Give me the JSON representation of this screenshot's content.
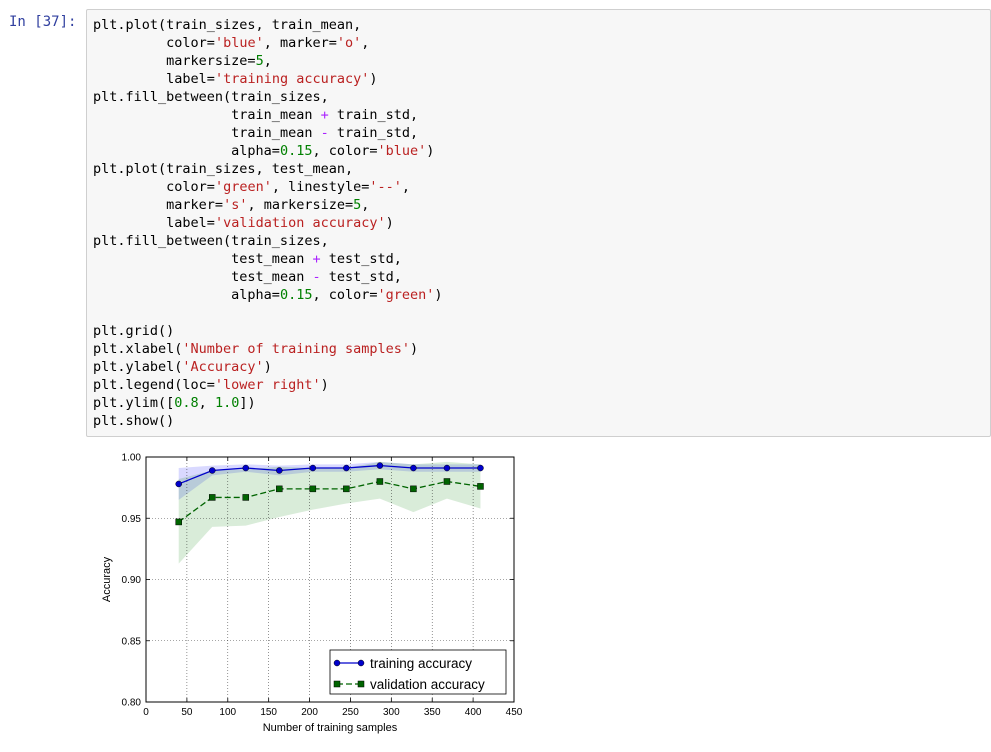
{
  "cell": {
    "prompt": "In [37]:",
    "lines": [
      {
        "indent": "",
        "parts": [
          {
            "t": "plt.plot(train_sizes, train_mean,"
          }
        ]
      },
      {
        "indent": "         ",
        "parts": [
          {
            "t": "color="
          },
          {
            "t": "'blue'",
            "c": "str"
          },
          {
            "t": ", marker="
          },
          {
            "t": "'o'",
            "c": "str"
          },
          {
            "t": ","
          }
        ]
      },
      {
        "indent": "         ",
        "parts": [
          {
            "t": "markersize="
          },
          {
            "t": "5",
            "c": "num"
          },
          {
            "t": ","
          }
        ]
      },
      {
        "indent": "         ",
        "parts": [
          {
            "t": "label="
          },
          {
            "t": "'training accuracy'",
            "c": "str"
          },
          {
            "t": ")"
          }
        ]
      },
      {
        "indent": "",
        "parts": [
          {
            "t": "plt.fill_between(train_sizes,"
          }
        ]
      },
      {
        "indent": "                 ",
        "parts": [
          {
            "t": "train_mean "
          },
          {
            "t": "+",
            "c": "op"
          },
          {
            "t": " train_std,"
          }
        ]
      },
      {
        "indent": "                 ",
        "parts": [
          {
            "t": "train_mean "
          },
          {
            "t": "-",
            "c": "op"
          },
          {
            "t": " train_std,"
          }
        ]
      },
      {
        "indent": "                 ",
        "parts": [
          {
            "t": "alpha="
          },
          {
            "t": "0.15",
            "c": "num"
          },
          {
            "t": ", color="
          },
          {
            "t": "'blue'",
            "c": "str"
          },
          {
            "t": ")"
          }
        ]
      },
      {
        "indent": "",
        "parts": [
          {
            "t": "plt.plot(train_sizes, test_mean,"
          }
        ]
      },
      {
        "indent": "         ",
        "parts": [
          {
            "t": "color="
          },
          {
            "t": "'green'",
            "c": "str"
          },
          {
            "t": ", linestyle="
          },
          {
            "t": "'--'",
            "c": "str"
          },
          {
            "t": ","
          }
        ]
      },
      {
        "indent": "         ",
        "parts": [
          {
            "t": "marker="
          },
          {
            "t": "'s'",
            "c": "str"
          },
          {
            "t": ", markersize="
          },
          {
            "t": "5",
            "c": "num"
          },
          {
            "t": ","
          }
        ]
      },
      {
        "indent": "         ",
        "parts": [
          {
            "t": "label="
          },
          {
            "t": "'validation accuracy'",
            "c": "str"
          },
          {
            "t": ")"
          }
        ]
      },
      {
        "indent": "",
        "parts": [
          {
            "t": "plt.fill_between(train_sizes,"
          }
        ]
      },
      {
        "indent": "                 ",
        "parts": [
          {
            "t": "test_mean "
          },
          {
            "t": "+",
            "c": "op"
          },
          {
            "t": " test_std,"
          }
        ]
      },
      {
        "indent": "                 ",
        "parts": [
          {
            "t": "test_mean "
          },
          {
            "t": "-",
            "c": "op"
          },
          {
            "t": " test_std,"
          }
        ]
      },
      {
        "indent": "                 ",
        "parts": [
          {
            "t": "alpha="
          },
          {
            "t": "0.15",
            "c": "num"
          },
          {
            "t": ", color="
          },
          {
            "t": "'green'",
            "c": "str"
          },
          {
            "t": ")"
          }
        ]
      },
      {
        "indent": "",
        "parts": []
      },
      {
        "indent": "",
        "parts": [
          {
            "t": "plt.grid()"
          }
        ]
      },
      {
        "indent": "",
        "parts": [
          {
            "t": "plt.xlabel("
          },
          {
            "t": "'Number of training samples'",
            "c": "str"
          },
          {
            "t": ")"
          }
        ]
      },
      {
        "indent": "",
        "parts": [
          {
            "t": "plt.ylabel("
          },
          {
            "t": "'Accuracy'",
            "c": "str"
          },
          {
            "t": ")"
          }
        ]
      },
      {
        "indent": "",
        "parts": [
          {
            "t": "plt.legend(loc="
          },
          {
            "t": "'lower right'",
            "c": "str"
          },
          {
            "t": ")"
          }
        ]
      },
      {
        "indent": "",
        "parts": [
          {
            "t": "plt.ylim(["
          },
          {
            "t": "0.8",
            "c": "num"
          },
          {
            "t": ", "
          },
          {
            "t": "1.0",
            "c": "num"
          },
          {
            "t": "])"
          }
        ]
      },
      {
        "indent": "",
        "parts": [
          {
            "t": "plt.show()"
          }
        ]
      }
    ]
  },
  "colors": {
    "string": "#ba2121",
    "number": "#008000",
    "operator": "#aa22ff",
    "prompt": "#303f9f",
    "cell_bg": "#f7f7f7",
    "cell_border": "#cfcfcf",
    "train": "#0000cc",
    "validation": "#006400",
    "train_band": "#0000ff",
    "validation_band": "#008000"
  },
  "chart_data": {
    "type": "line",
    "xlabel": "Number of training samples",
    "ylabel": "Accuracy",
    "xlim": [
      0,
      450
    ],
    "ylim": [
      0.8,
      1.0
    ],
    "xticks": [
      0,
      50,
      100,
      150,
      200,
      250,
      300,
      350,
      400,
      450
    ],
    "yticks": [
      0.8,
      0.85,
      0.9,
      0.95,
      1.0
    ],
    "xtick_labels": [
      "0",
      "50",
      "100",
      "150",
      "200",
      "250",
      "300",
      "350",
      "400",
      "450"
    ],
    "ytick_labels": [
      "0.80",
      "0.85",
      "0.90",
      "0.95",
      "1.00"
    ],
    "grid": true,
    "legend_position": "lower right",
    "x": [
      40,
      81,
      122,
      163,
      204,
      245,
      286,
      327,
      368,
      409
    ],
    "series": [
      {
        "name": "training accuracy",
        "marker": "circle",
        "linestyle": "solid",
        "values": [
          0.978,
          0.989,
          0.991,
          0.989,
          0.991,
          0.991,
          0.993,
          0.991,
          0.991,
          0.991
        ],
        "band_upper": [
          0.991,
          0.993,
          0.994,
          0.993,
          0.994,
          0.994,
          0.996,
          0.994,
          0.994,
          0.994
        ],
        "band_lower": [
          0.965,
          0.985,
          0.988,
          0.985,
          0.988,
          0.988,
          0.99,
          0.988,
          0.988,
          0.988
        ]
      },
      {
        "name": "validation accuracy",
        "marker": "square",
        "linestyle": "dashed",
        "values": [
          0.947,
          0.967,
          0.967,
          0.974,
          0.974,
          0.974,
          0.98,
          0.974,
          0.98,
          0.976
        ],
        "band_upper": [
          0.982,
          0.989,
          0.99,
          0.992,
          0.991,
          0.991,
          0.996,
          0.994,
          0.996,
          0.994
        ],
        "band_lower": [
          0.913,
          0.943,
          0.944,
          0.951,
          0.957,
          0.962,
          0.966,
          0.955,
          0.966,
          0.958
        ]
      }
    ]
  }
}
